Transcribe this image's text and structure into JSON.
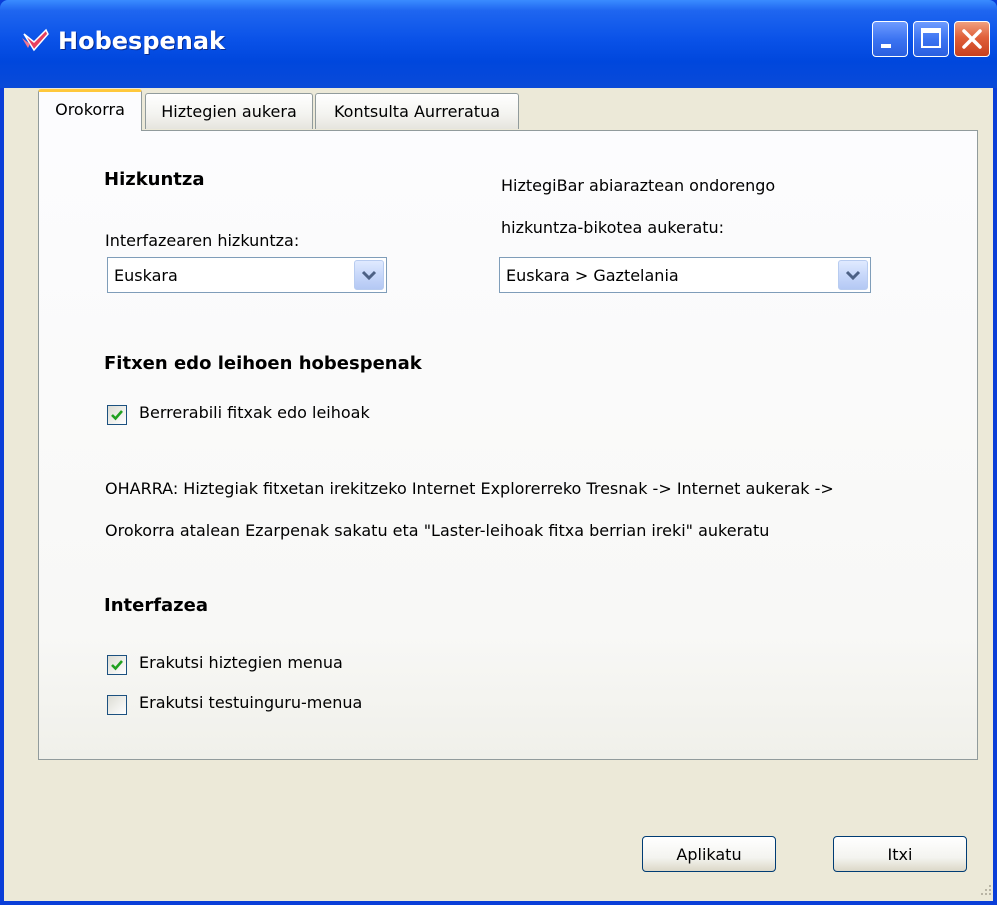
{
  "window": {
    "title": "Hobespenak",
    "icon": "app-heart-icon"
  },
  "tabs": [
    {
      "label": "Orokorra",
      "active": true
    },
    {
      "label": "Hiztegien aukera",
      "active": false
    },
    {
      "label": "Kontsulta Aurreratua",
      "active": false
    }
  ],
  "language": {
    "heading": "Hizkuntza",
    "interface_label": "Interfazearen hizkuntza:",
    "interface_value": "Euskara",
    "startup_label_line1": "HiztegiBar abiaraztean ondorengo",
    "startup_label_line2": "hizkuntza-bikotea aukeratu:",
    "startup_value": "Euskara > Gaztelania"
  },
  "tabs_section": {
    "heading": "Fitxen edo leihoen hobespenak",
    "reuse_label": "Berrerabili fitxak edo leihoak",
    "reuse_checked": true,
    "note_line1": "OHARRA: Hiztegiak fitxetan irekitzeko Internet Explorerreko Tresnak -> Internet aukerak ->",
    "note_line2": "Orokorra atalean Ezarpenak sakatu eta \"Laster-leihoak fitxa berrian ireki\" aukeratu"
  },
  "interface": {
    "heading": "Interfazea",
    "show_menu_label": "Erakutsi hiztegien menua",
    "show_menu_checked": true,
    "show_context_label": "Erakutsi testuinguru-menua",
    "show_context_checked": false
  },
  "buttons": {
    "apply": "Aplikatu",
    "close": "Itxi"
  },
  "colors": {
    "titlebar": "#0A52E8",
    "close_button": "#E0603A",
    "check": "#21A121",
    "active_tab_accent": "#FFC83C"
  }
}
